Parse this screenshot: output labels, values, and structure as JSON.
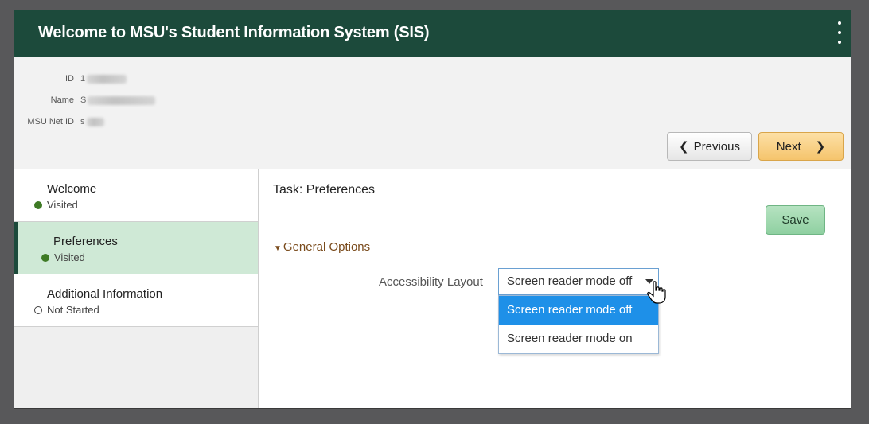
{
  "header": {
    "title": "Welcome to MSU's Student Information System (SIS)",
    "menu_icon": "kebab-menu-icon"
  },
  "student": {
    "id_label": "ID",
    "id_value": "1",
    "name_label": "Name",
    "name_value": "S",
    "netid_label": "MSU Net ID",
    "netid_value": "s"
  },
  "nav": {
    "previous_label": "Previous",
    "next_label": "Next"
  },
  "sidebar": {
    "items": [
      {
        "label": "Welcome",
        "status": "Visited"
      },
      {
        "label": "Preferences",
        "status": "Visited"
      },
      {
        "label": "Additional Information",
        "status": "Not Started"
      }
    ]
  },
  "main": {
    "task_title": "Task: Preferences",
    "save_label": "Save",
    "section_title": "General Options",
    "field_label": "Accessibility Layout",
    "select_value": "Screen reader mode off",
    "options": [
      "Screen reader mode off",
      "Screen reader mode on"
    ]
  },
  "colors": {
    "header_bg": "#1c4a3b",
    "active_item_bg": "#cfe9d6",
    "next_button": "#f5c46c",
    "save_button": "#8fd0a1",
    "selected_option": "#1e90e8",
    "section_header_text": "#7a4b1c"
  }
}
